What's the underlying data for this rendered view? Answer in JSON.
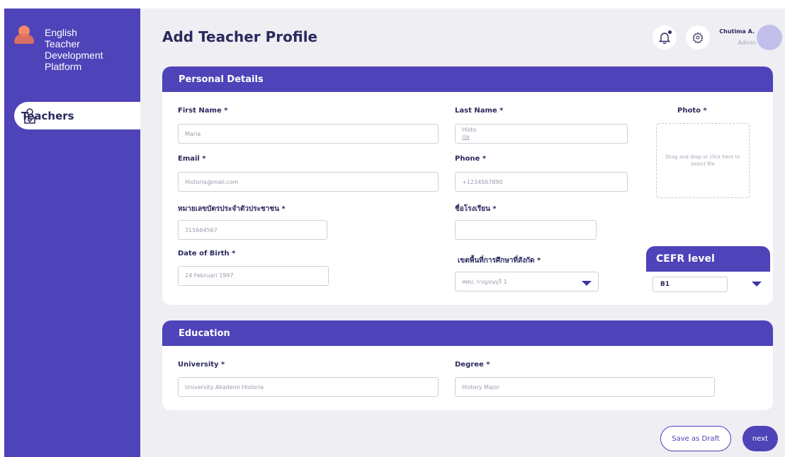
{
  "app": {
    "brand": "English Teacher Development Platform",
    "brand_lines": [
      "English",
      "Teacher",
      "Development",
      "Platform"
    ]
  },
  "sidebar": {
    "items": [
      {
        "label": "Teachers",
        "icon": "teacher-icon",
        "active": true
      }
    ]
  },
  "header": {
    "title": "Add  Teacher Profile",
    "user": {
      "name": "Chutima A.",
      "role": "Admin"
    },
    "icons": [
      "bell-icon",
      "gear-icon"
    ]
  },
  "personal": {
    "section_title": "Personal Details",
    "first_name": {
      "label": "First Name *",
      "value": "Maria"
    },
    "last_name": {
      "label": "Last Name *",
      "value_line1": "Histo",
      "value_line2": "ria"
    },
    "photo": {
      "label": "Photo *",
      "hint": "Drag and drop or click here to select file"
    },
    "email": {
      "label": "Email *",
      "value": "Historia@mail.com"
    },
    "phone": {
      "label": "Phone *",
      "value": "+1234567890"
    },
    "id_card": {
      "label": "หมายเลขบัตรประจำตัวประชาชน *",
      "value": "315664567"
    },
    "school": {
      "label": "ชื่อโรงเรียน *",
      "value": ""
    },
    "dob": {
      "label": "Date of Birth *",
      "value": "24 Februari 1997"
    },
    "area": {
      "label": "เขตพื้นที่การศึกษาที่สังกัด *",
      "value": "สพป. กาญจนบุรี 1"
    },
    "cefr": {
      "label": "CEFR level",
      "value": "B1"
    }
  },
  "education": {
    "section_title": "Education",
    "university": {
      "label": "University *",
      "value": "University Akademi Historia"
    },
    "degree": {
      "label": "Degree *",
      "value": "History Major"
    }
  },
  "actions": {
    "save_draft": "Save as Draft",
    "next": "next"
  },
  "colors": {
    "primary": "#4e43b8",
    "background": "#eeeef3",
    "text": "#2b2a5e",
    "accent": "#f2876a"
  }
}
